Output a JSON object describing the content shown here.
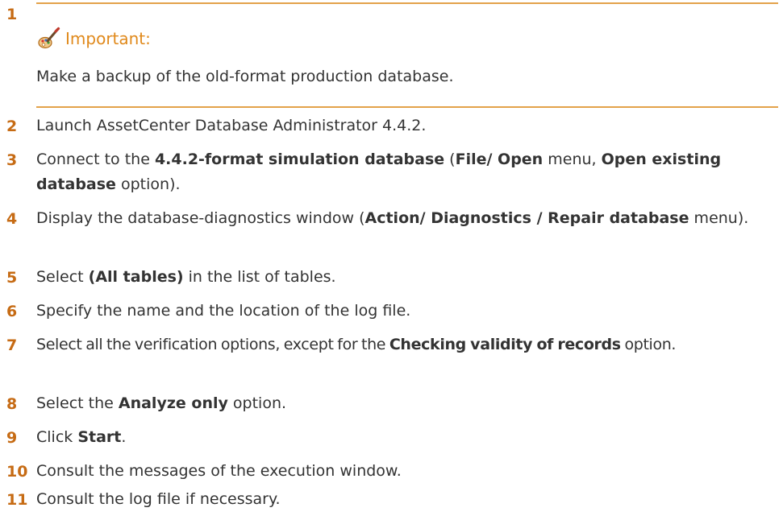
{
  "colors": {
    "accent": "#c66b14",
    "rule": "#e3a24a",
    "important_label": "#e0891b",
    "text": "#333333"
  },
  "note": {
    "step": "1",
    "icon": "paintbrush-note-icon",
    "label": "Important:",
    "body": "Make a backup of the old-format production database."
  },
  "steps": [
    {
      "num": "2"
    },
    {
      "num": "3"
    },
    {
      "num": "4"
    },
    {
      "num": "5"
    },
    {
      "num": "6"
    },
    {
      "num": "7"
    },
    {
      "num": "8"
    },
    {
      "num": "9"
    },
    {
      "num": "10"
    },
    {
      "num": "11"
    }
  ],
  "text": {
    "s2": "Launch AssetCenter Database Administrator 4.4.2.",
    "s3_a": "Connect to the ",
    "s3_b": "4.4.2-format simulation database",
    "s3_c": " (",
    "s3_d": "File/ Open",
    "s3_e": " menu, ",
    "s3_f": "Open existing database",
    "s3_g": " option).",
    "s4_a": "Display the database-diagnostics window (",
    "s4_b": "Action/ Diagnostics / Repair database",
    "s4_c": " menu).",
    "s5_a": "Select ",
    "s5_b": "(All tables)",
    "s5_c": " in the list of tables.",
    "s6": "Specify the name and the location of the log file.",
    "s7_a": "Select all the verification options, except for the ",
    "s7_b": "Checking validity of records",
    "s7_c": " option.",
    "s8_a": "Select the ",
    "s8_b": "Analyze only",
    "s8_c": " option.",
    "s9_a": "Click ",
    "s9_b": "Start",
    "s9_c": ".",
    "s10": "Consult the messages of the execution window.",
    "s11": "Consult the log file if necessary."
  }
}
